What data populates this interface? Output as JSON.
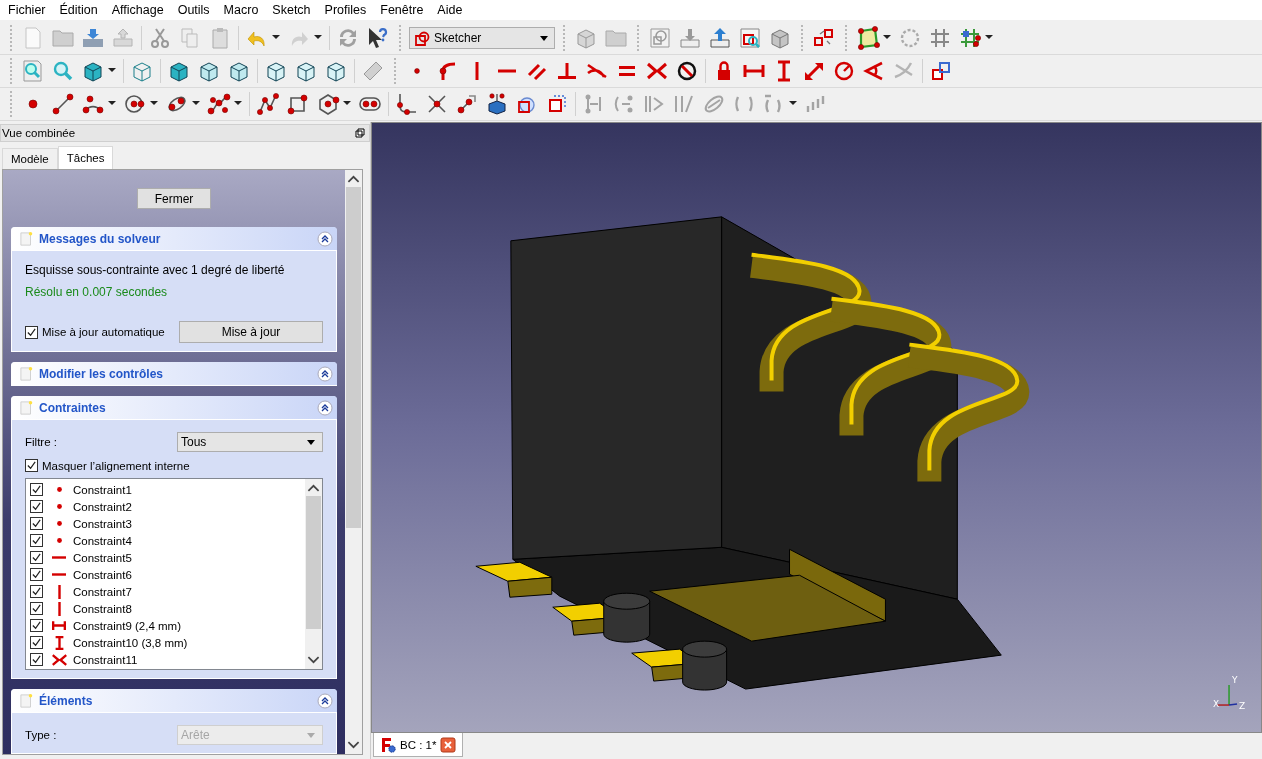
{
  "menu_bar": [
    "Fichier",
    "Édition",
    "Affichage",
    "Outils",
    "Macro",
    "Sketch",
    "Profiles",
    "Fenêtre",
    "Aide"
  ],
  "workbench_selector": {
    "value": "Sketcher"
  },
  "combo_view": {
    "title": "Vue combinée",
    "tabs": [
      {
        "label": "Modèle",
        "selected": false
      },
      {
        "label": "Tâches",
        "selected": true
      }
    ]
  },
  "task_panel": {
    "close_button": "Fermer",
    "sections": [
      {
        "kind": "solver",
        "title": "Messages du solveur",
        "message": "Esquisse sous-contrainte avec 1 degré de liberté",
        "status": "Résolu en 0.007 secondes",
        "auto_update": {
          "label": "Mise à jour automatique",
          "checked": true
        },
        "update_button": "Mise à jour"
      },
      {
        "kind": "header",
        "title": "Modifier les contrôles"
      },
      {
        "kind": "constraints",
        "title": "Contraintes",
        "filter_label": "Filtre :",
        "filter_value": "Tous",
        "hide_internal": {
          "label": "Masquer l’alignement interne",
          "checked": true
        },
        "constraints": [
          {
            "label": "Constraint1",
            "kind": "coincident",
            "checked": true
          },
          {
            "label": "Constraint2",
            "kind": "coincident",
            "checked": true
          },
          {
            "label": "Constraint3",
            "kind": "coincident",
            "checked": true
          },
          {
            "label": "Constraint4",
            "kind": "coincident",
            "checked": true
          },
          {
            "label": "Constraint5",
            "kind": "horizontal",
            "checked": true
          },
          {
            "label": "Constraint6",
            "kind": "horizontal",
            "checked": true
          },
          {
            "label": "Constraint7",
            "kind": "vertical",
            "checked": true
          },
          {
            "label": "Constraint8",
            "kind": "vertical",
            "checked": true
          },
          {
            "label": "Constraint9 (2,4 mm)",
            "kind": "distance_x",
            "checked": true
          },
          {
            "label": "Constraint10 (3,8 mm)",
            "kind": "distance_y",
            "checked": true
          },
          {
            "label": "Constraint11",
            "kind": "symmetric",
            "checked": true
          }
        ]
      },
      {
        "kind": "elements",
        "title": "Éléments",
        "type_label": "Type :",
        "type_value": "Arête",
        "disabled": true
      }
    ]
  },
  "viewport": {
    "axis_labels": [
      {
        "label": "Y",
        "kind": "y"
      },
      {
        "label": "X",
        "kind": "x"
      },
      {
        "label": "Z",
        "kind": "z"
      }
    ]
  },
  "document_tabs": [
    {
      "label": "BC : 1*",
      "selected": true
    }
  ]
}
